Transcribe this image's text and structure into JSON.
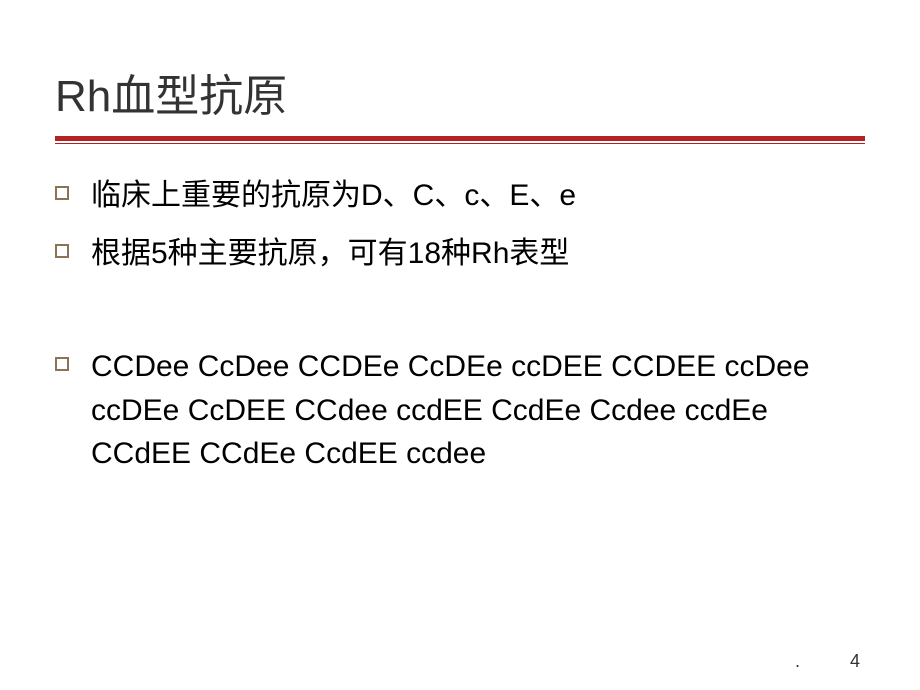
{
  "slide": {
    "title": "Rh血型抗原",
    "bullets": [
      "临床上重要的抗原为D、C、c、E、e",
      "根据5种主要抗原，可有18种Rh表型"
    ],
    "phenotypes": "CCDee  CcDee CCDEe CcDEe ccDEE CCDEE  ccDee  ccDEe CcDEE CCdee ccdEE   CcdEe  Ccdee  ccdEe  CCdEE CCdEe  CcdEE  ccdee"
  },
  "footer": {
    "dot": ".",
    "page_number": "4"
  }
}
